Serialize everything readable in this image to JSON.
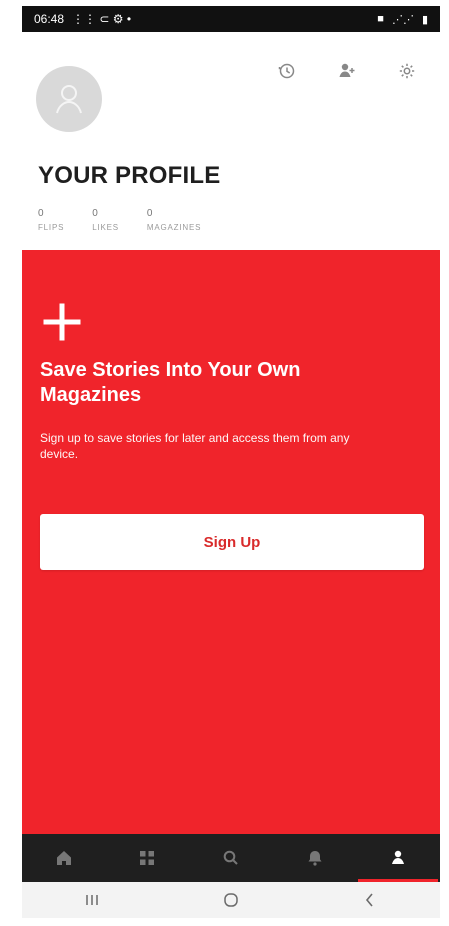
{
  "status_bar": {
    "time": "06:48",
    "left_icons": [
      "notification-icons",
      "dot-icon"
    ],
    "right_icons": [
      "battery-saver-icon",
      "signal-icon",
      "battery-icon"
    ]
  },
  "profile": {
    "title": "YOUR PROFILE",
    "stats": [
      {
        "value": "0",
        "label": "FLIPS"
      },
      {
        "value": "0",
        "label": "LIKES"
      },
      {
        "value": "0",
        "label": "MAGAZINES"
      }
    ],
    "top_actions": [
      "history-icon",
      "add-user-icon",
      "settings-icon"
    ]
  },
  "promo": {
    "title": "Save Stories Into Your Own Magazines",
    "description": "Sign up to save stories for later and access them from any device.",
    "button_label": "Sign Up"
  },
  "tabs": [
    {
      "icon": "home-icon"
    },
    {
      "icon": "grid-icon"
    },
    {
      "icon": "search-icon"
    },
    {
      "icon": "notification-icon"
    },
    {
      "icon": "profile-icon"
    }
  ],
  "colors": {
    "promo_red": "#f0242b",
    "signup_text": "#d92b2b",
    "tabbar_bg": "#1f1f1f"
  }
}
